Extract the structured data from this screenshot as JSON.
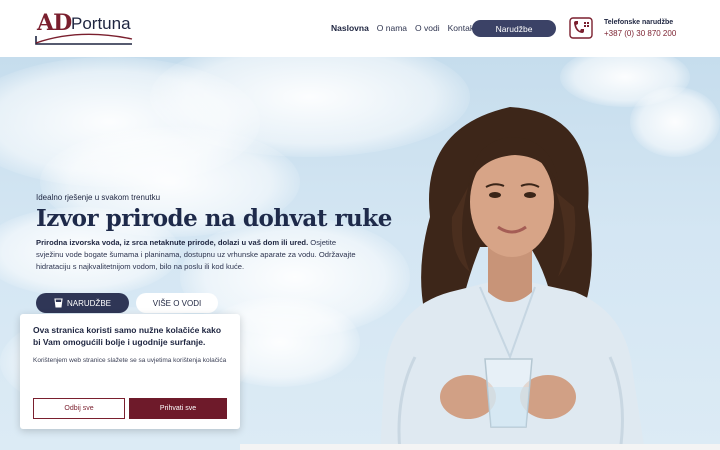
{
  "brand": {
    "logo_ad": "AD",
    "logo_name": "Portuna"
  },
  "nav": {
    "items": [
      "Naslovna",
      "O nama",
      "O vodi",
      "Kontakt"
    ],
    "active_index": 0
  },
  "header": {
    "order_button": "Narudžbe",
    "phone_label": "Telefonske narudžbe",
    "phone_number": "+387 (0) 30 870 200"
  },
  "hero": {
    "eyebrow": "Idealno rješenje u svakom trenutku",
    "headline": "Izvor prirode na dohvat ruke",
    "body_bold": "Prirodna izvorska voda, iz srca netaknute prirode, dolazi u vaš dom ili ured.",
    "body_rest": " Osjetite svježinu vode bogate šumama i planinama, dostupnu uz vrhunske aparate za vodu. Održavajte hidrataciju s najkvalitetnijom vodom, bilo na poslu ili kod kuće.",
    "primary_button": "NARUDŽBE",
    "secondary_button": "VIŠE O VODI"
  },
  "cookie": {
    "title": "Ova stranica koristi samo nužne kolačiće kako bi Vam omogućili bolje i ugodnije surfanje.",
    "text": "Korištenjem web stranice slažete se sa uvjetima korištenja kolačića",
    "decline": "Odbij sve",
    "accept": "Prihvati sve"
  },
  "colors": {
    "brand_navy": "#2f3656",
    "brand_maroon": "#7a1f2e",
    "sky": "#c6dded"
  },
  "icons": {
    "phone": "phone-icon",
    "cup": "water-cup-icon"
  }
}
